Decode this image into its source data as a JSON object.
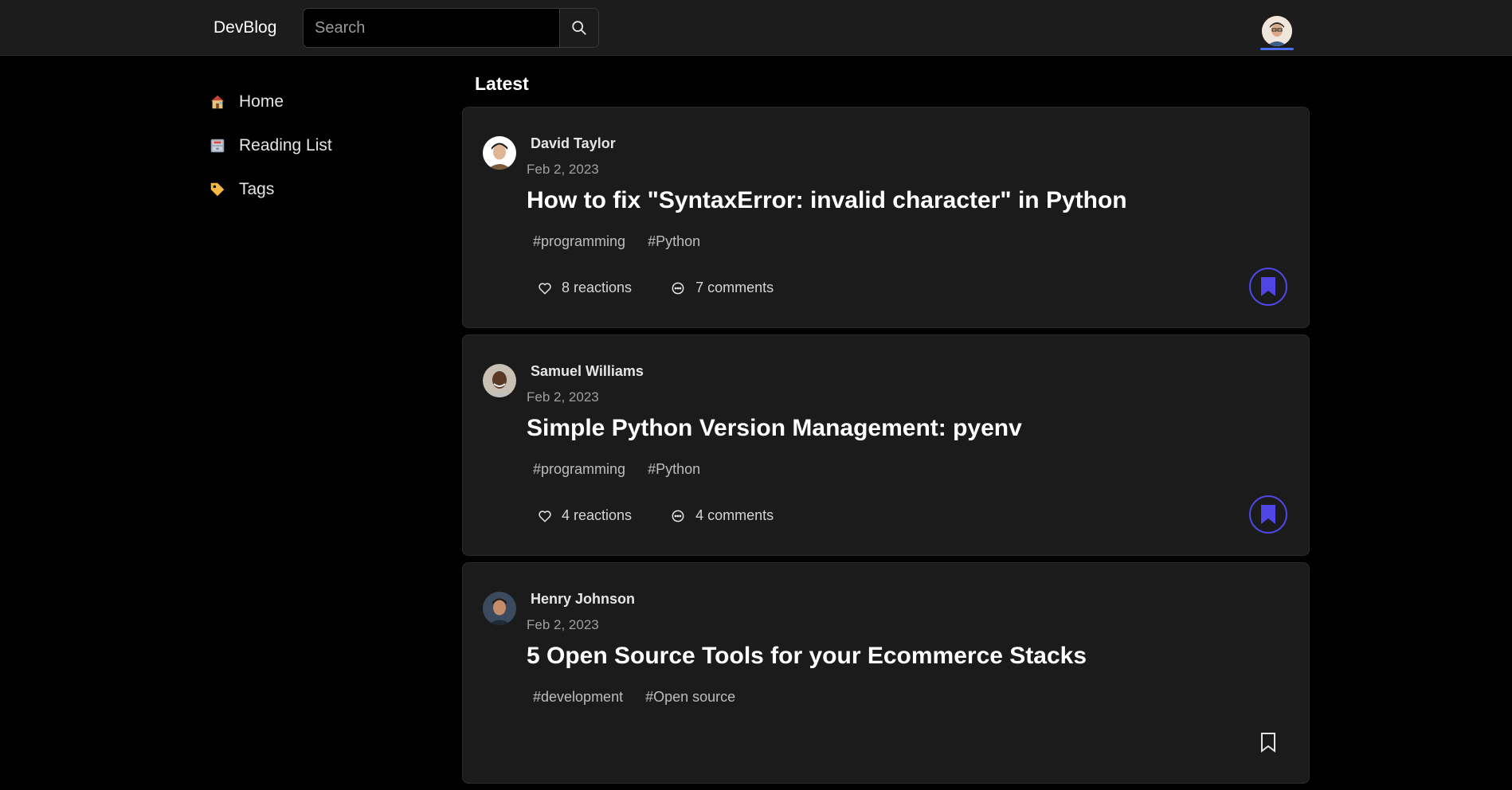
{
  "header": {
    "brand": "DevBlog",
    "search_placeholder": "Search",
    "search_value": ""
  },
  "sidebar": {
    "items": [
      {
        "label": "Home",
        "icon": "house-icon"
      },
      {
        "label": "Reading List",
        "icon": "file-cabinet-icon"
      },
      {
        "label": "Tags",
        "icon": "tag-icon"
      }
    ]
  },
  "feed": {
    "heading": "Latest",
    "posts": [
      {
        "author": "David Taylor",
        "date": "Feb 2, 2023",
        "title": "How to fix \"SyntaxError: invalid character\" in Python",
        "tags": [
          "#programming",
          "#Python"
        ],
        "reactions": "8 reactions",
        "comments": "7 comments",
        "bookmarked": true
      },
      {
        "author": "Samuel Williams",
        "date": "Feb 2, 2023",
        "title": "Simple Python Version Management: pyenv",
        "tags": [
          "#programming",
          "#Python"
        ],
        "reactions": "4 reactions",
        "comments": "4 comments",
        "bookmarked": true
      },
      {
        "author": "Henry Johnson",
        "date": "Feb 2, 2023",
        "title": "5 Open Source Tools for your Ecommerce Stacks",
        "tags": [
          "#development",
          "#Open source"
        ],
        "reactions": "",
        "comments": "",
        "bookmarked": false
      }
    ]
  },
  "colors": {
    "background": "#000000",
    "surface": "#1b1b1b",
    "accent": "#4f46e5",
    "active_underline": "#4c6ef5"
  }
}
